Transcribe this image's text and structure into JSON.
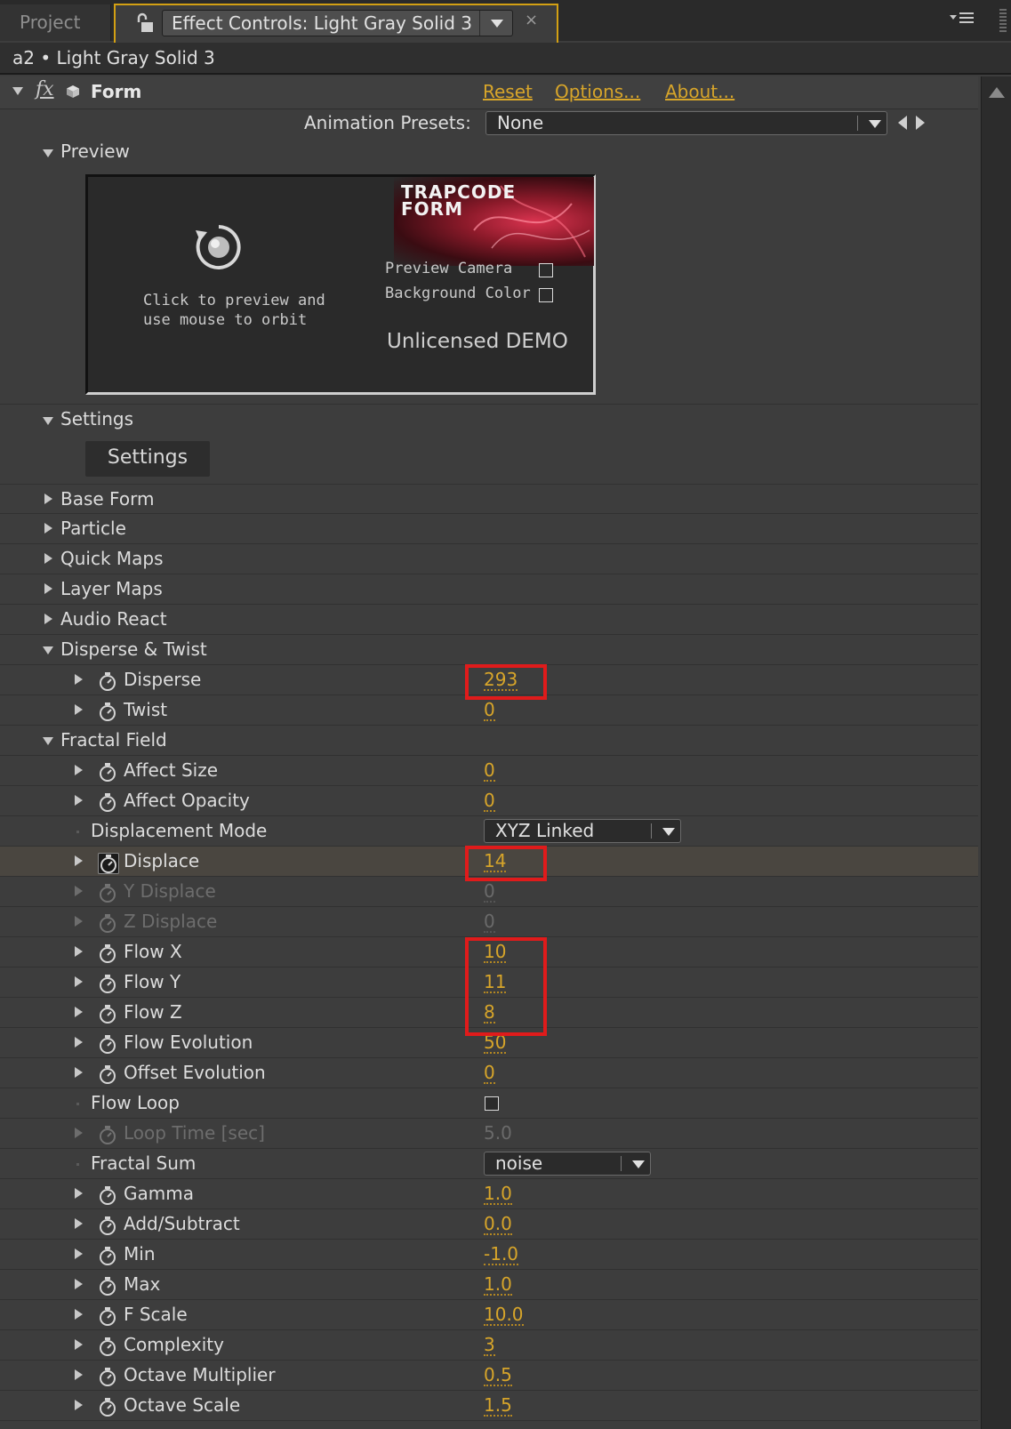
{
  "tabs": {
    "project_label": "Project",
    "active_label": "Effect Controls: Light Gray Solid 3",
    "close_glyph": "×"
  },
  "layer_name": "a2 • Light Gray Solid 3",
  "effect": {
    "name": "Form",
    "reset_label": "Reset",
    "options_label": "Options...",
    "about_label": "About..."
  },
  "presets": {
    "label": "Animation Presets:",
    "value": "None"
  },
  "preview": {
    "section_label": "Preview",
    "instructions_line1": "Click to preview and",
    "instructions_line2": "use mouse to orbit",
    "logo_line1": "TRAPCODE",
    "logo_line2": "FORM",
    "preview_camera_label": "Preview Camera",
    "background_color_label": "Background Color",
    "demo_text": "Unlicensed DEMO"
  },
  "settings": {
    "section_label": "Settings",
    "button_label": "Settings"
  },
  "groups": [
    {
      "label": "Base Form"
    },
    {
      "label": "Particle"
    },
    {
      "label": "Quick Maps"
    },
    {
      "label": "Layer Maps"
    },
    {
      "label": "Audio React"
    }
  ],
  "disperse_twist": {
    "label": "Disperse & Twist",
    "params": [
      {
        "label": "Disperse",
        "value": "293"
      },
      {
        "label": "Twist",
        "value": "0"
      }
    ]
  },
  "fractal_field": {
    "label": "Fractal Field",
    "affect_size": {
      "label": "Affect Size",
      "value": "0"
    },
    "affect_opacity": {
      "label": "Affect Opacity",
      "value": "0"
    },
    "displacement_mode": {
      "label": "Displacement Mode",
      "value": "XYZ Linked"
    },
    "displace": {
      "label": "Displace",
      "value": "14"
    },
    "y_displace": {
      "label": "Y Displace",
      "value": "0"
    },
    "z_displace": {
      "label": "Z Displace",
      "value": "0"
    },
    "flow_x": {
      "label": "Flow X",
      "value": "10"
    },
    "flow_y": {
      "label": "Flow Y",
      "value": "11"
    },
    "flow_z": {
      "label": "Flow Z",
      "value": "8"
    },
    "flow_evolution": {
      "label": "Flow Evolution",
      "value": "50"
    },
    "offset_evolution": {
      "label": "Offset Evolution",
      "value": "0"
    },
    "flow_loop": {
      "label": "Flow Loop"
    },
    "loop_time": {
      "label": "Loop Time [sec]",
      "value": "5.0"
    },
    "fractal_sum": {
      "label": "Fractal Sum",
      "value": "noise"
    },
    "gamma": {
      "label": "Gamma",
      "value": "1.0"
    },
    "add_subtract": {
      "label": "Add/Subtract",
      "value": "0.0"
    },
    "min": {
      "label": "Min",
      "value": "-1.0"
    },
    "max": {
      "label": "Max",
      "value": "1.0"
    },
    "f_scale": {
      "label": "F Scale",
      "value": "10.0"
    },
    "complexity": {
      "label": "Complexity",
      "value": "3"
    },
    "octave_multiplier": {
      "label": "Octave Multiplier",
      "value": "0.5"
    },
    "octave_scale": {
      "label": "Octave Scale",
      "value": "1.5"
    }
  },
  "colors": {
    "accent": "#d3a013",
    "value_text": "#d7a52a",
    "annotation": "#e01b1b",
    "panel_bg": "#3d3d3d"
  },
  "icons": {
    "lock": "lock-icon",
    "panel_menu": "panel-menu-icon",
    "stopwatch": "stopwatch-icon",
    "orbit": "orbit-icon",
    "fx": "fx-icon"
  }
}
